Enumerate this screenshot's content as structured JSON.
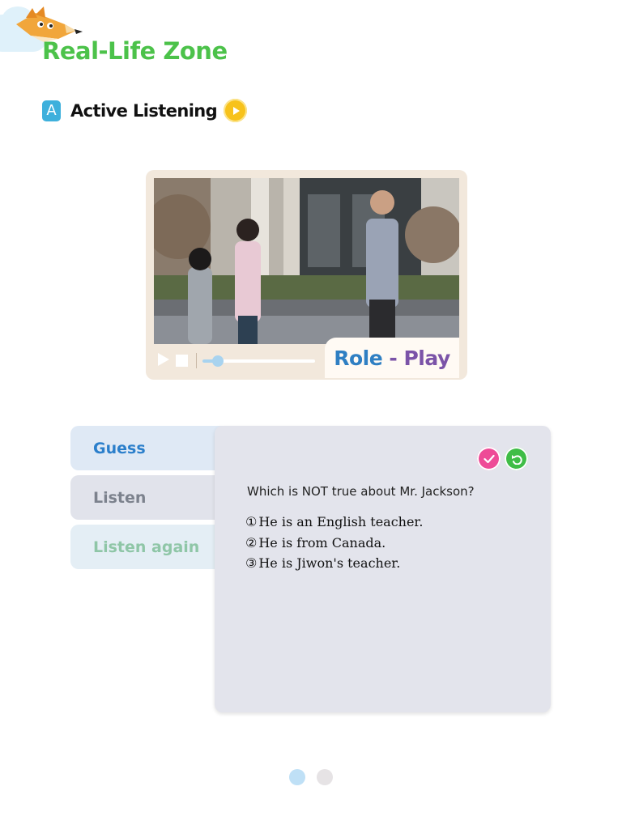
{
  "header": {
    "zone_title": "Real-Life Zone",
    "section_letter": "A",
    "section_title": "Active Listening",
    "mascot": "fox-pencil-icon",
    "play_icon": "play-circle-icon"
  },
  "video": {
    "badge_role": "Role",
    "badge_dash": "-",
    "badge_play": "Play",
    "controls": [
      "play-icon",
      "stop-icon"
    ],
    "progress": 0.1
  },
  "tabs": [
    {
      "label": "Guess"
    },
    {
      "label": "Listen"
    },
    {
      "label": "Listen again"
    }
  ],
  "panel": {
    "question": "Which is NOT true about Mr. Jackson?",
    "options": [
      {
        "num": "①",
        "text": "He is an English teacher."
      },
      {
        "num": "②",
        "text": "He is from Canada."
      },
      {
        "num": "③",
        "text": "He is Jiwon's teacher."
      }
    ],
    "actions": [
      "check-icon",
      "undo-icon"
    ]
  },
  "pagination": {
    "pages": 2,
    "current": 1
  },
  "colors": {
    "zone_green": "#4cc24a",
    "accent_blue": "#3eb0dc",
    "play_yellow": "#f7c21b",
    "check_pink": "#ee4b97",
    "undo_green": "#3fbd46"
  }
}
